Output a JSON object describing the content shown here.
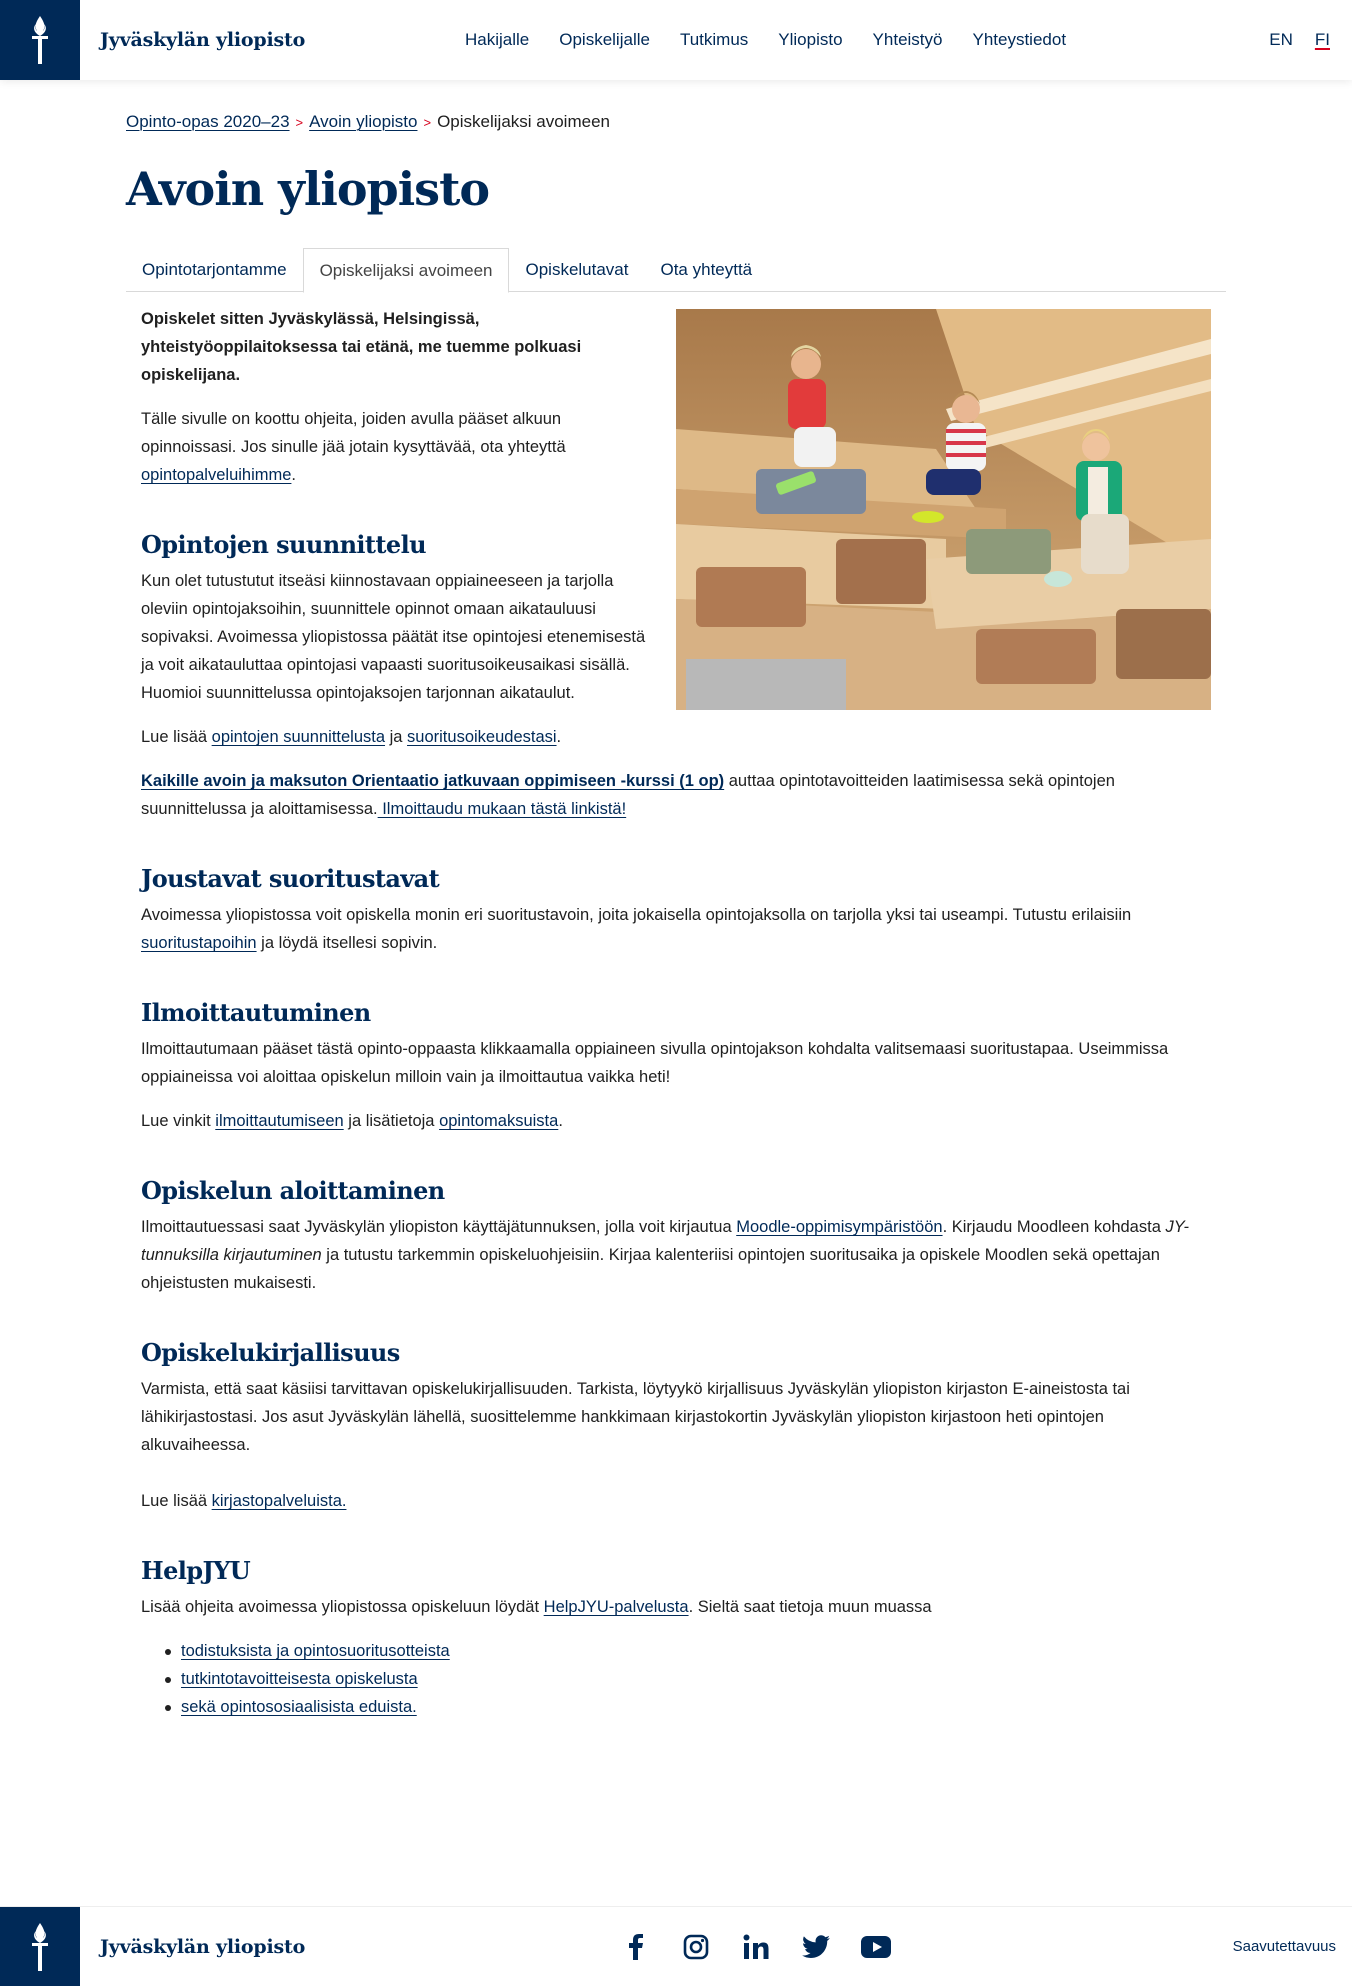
{
  "header": {
    "brand": "Jyväskylän yliopisto",
    "logo_icon": "torch-logo-icon",
    "nav": [
      "Hakijalle",
      "Opiskelijalle",
      "Tutkimus",
      "Yliopisto",
      "Yhteistyö",
      "Yhteystiedot"
    ],
    "languages": [
      {
        "label": "EN",
        "active": false
      },
      {
        "label": "FI",
        "active": true
      }
    ]
  },
  "breadcrumb": {
    "items": [
      "Opinto-opas 2020–23",
      "Avoin yliopisto"
    ],
    "separator": ">",
    "current": "Opiskelijaksi avoimeen"
  },
  "page_title": "Avoin yliopisto",
  "tabs": [
    {
      "label": "Opintotarjontamme",
      "active": false
    },
    {
      "label": "Opiskelijaksi avoimeen",
      "active": true
    },
    {
      "label": "Opiskelutavat",
      "active": false
    },
    {
      "label": "Ota yhteyttä",
      "active": false
    }
  ],
  "intro": {
    "lead": "Opiskelet sitten Jyväskylässä, Helsingissä, yhteistyöoppilaitoksessa tai etänä, me tuemme polkuasi opiskelijana.",
    "text": "Tälle sivulle on koottu ohjeita, joiden avulla pääset alkuun opinnoissasi. Jos sinulle jää jotain kysyttävää, ota yhteyttä",
    "link": "opintopalveluihimme",
    "end": "."
  },
  "sections": {
    "suunnittelu": {
      "title": "Opintojen suunnittelu",
      "p1": "Kun olet tutustutut itseäsi kiinnostavaan oppiaineeseen ja tarjolla oleviin opintojaksoihin, suunnittele opinnot omaan aikatauluusi sopivaksi. Avoimessa yliopistossa päätät itse opintojesi etenemisestä ja voit aikatauluttaa opintojasi vapaasti suoritusoikeusaikasi sisällä. Huomioi suunnittelussa opintojaksojen tarjonnan aikataulut.",
      "p2_pre": "Lue lisää ",
      "p2_link1": "opintojen suunnittelusta",
      "p2_mid": " ja ",
      "p2_link2": "suoritusoikeudestasi",
      "p2_end": ".",
      "p3_link": "Kaikille avoin ja maksuton Orientaatio jatkuvaan oppimiseen -kurssi (1 op)",
      "p3_text": " auttaa opintotavoitteiden laatimisessa sekä opintojen suunnittelussa ja aloittamisessa.",
      "p3_link2": " Ilmoittaudu mukaan tästä linkistä!"
    },
    "joustavat": {
      "title": "Joustavat suoritustavat",
      "p1_pre": "Avoimessa yliopistossa voit opiskella monin eri suoritustavoin, joita jokaisella opintojaksolla on tarjolla yksi tai useampi. Tutustu erilaisiin ",
      "p1_link": "suoritustapoihin",
      "p1_end": " ja löydä itsellesi sopivin."
    },
    "ilmoittautuminen": {
      "title": "Ilmoittautuminen",
      "p1": "Ilmoittautumaan pääset tästä opinto-oppaasta klikkaamalla oppiaineen sivulla opintojakson kohdalta valitsemaasi suoritustapaa. Useimmissa oppiaineissa voi aloittaa opiskelun milloin vain ja ilmoittautua vaikka heti!",
      "p2_pre": "Lue vinkit ",
      "p2_link1": "ilmoittautumiseen",
      "p2_mid": " ja lisätietoja ",
      "p2_link2": "opintomaksuista",
      "p2_end": "."
    },
    "aloittaminen": {
      "title": "Opiskelun aloittaminen",
      "p1_pre": "Ilmoittautuessasi saat Jyväskylän yliopiston käyttäjätunnuksen, jolla voit kirjautua ",
      "p1_link": "Moodle-oppimisympäristöön",
      "p1_mid": ". Kirjaudu Moodleen kohdasta ",
      "p1_em": "JY-tunnuksilla kirjautuminen",
      "p1_end": " ja tutustu tarkemmin opiskeluohjeisiin. Kirjaa kalenteriisi opintojen suoritusaika ja opiskele Moodlen sekä opettajan ohjeistusten mukaisesti."
    },
    "kirjallisuus": {
      "title": "Opiskelukirjallisuus",
      "p1": "Varmista, että saat käsiisi tarvittavan opiskelukirjallisuuden. Tarkista, löytyykö kirjallisuus Jyväskylän yliopiston kirjaston E-aineistosta tai lähikirjastostasi. Jos asut Jyväskylän lähellä, suosittelemme hankkimaan kirjastokortin Jyväskylän yliopiston kirjastoon heti opintojen alkuvaiheessa.",
      "p2_pre": "Lue lisää ",
      "p2_link": "kirjastopalveluista."
    },
    "helpjyu": {
      "title": "HelpJYU",
      "p1_pre": "Lisää ohjeita avoimessa yliopistossa opiskeluun löydät ",
      "p1_link": "HelpJYU-palvelusta",
      "p1_end": ". Sieltä saat tietoja muun muassa",
      "list": [
        "todistuksista ja opintosuoritusotteista",
        "tutkintotavoitteisesta opiskelusta",
        "sekä opintososiaalisista eduista."
      ]
    }
  },
  "image": {
    "icon": "photo-students-on-stairs"
  },
  "footer": {
    "brand": "Jyväskylän yliopisto",
    "social": [
      "facebook-icon",
      "instagram-icon",
      "linkedin-icon",
      "twitter-icon",
      "youtube-icon"
    ],
    "accessibility_link": "Saavutettavuus"
  },
  "colors": {
    "brand": "#002957",
    "accent": "#d6001c"
  }
}
